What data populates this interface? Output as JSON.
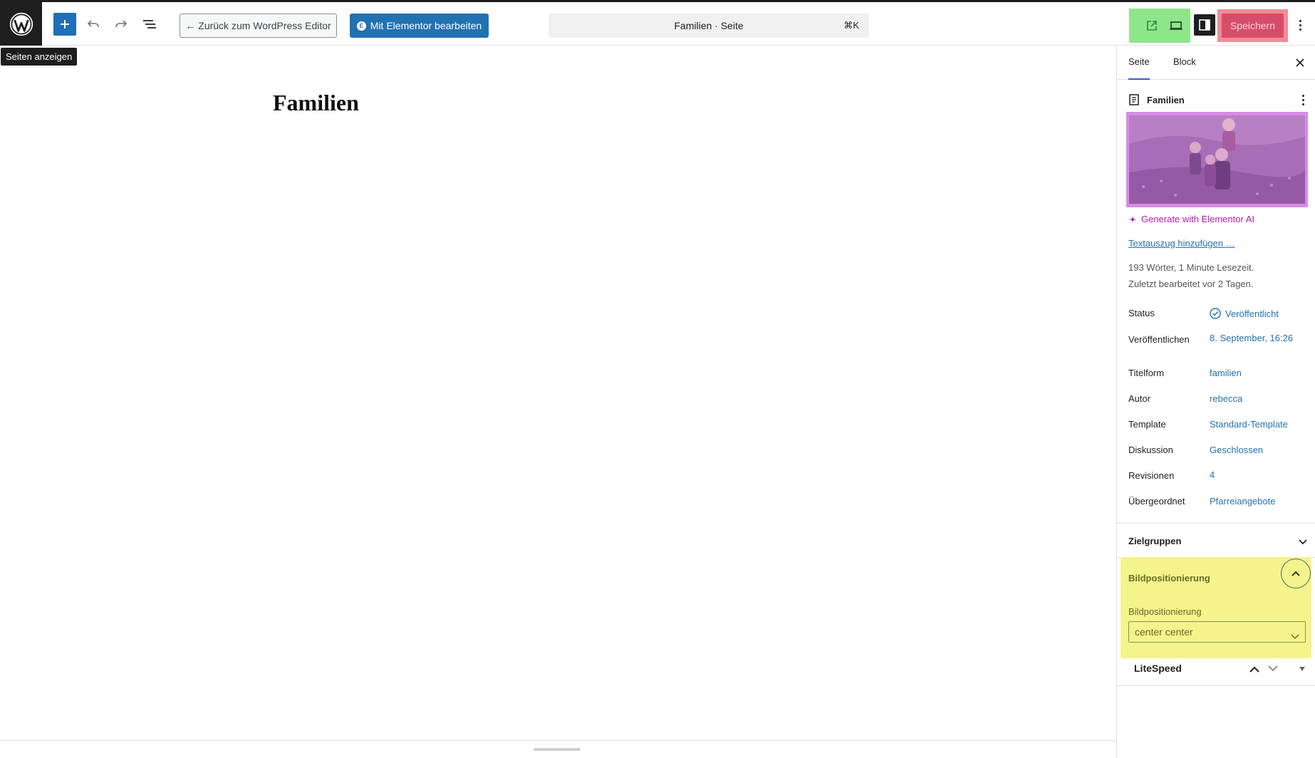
{
  "topbar": {
    "tooltip": "Seiten anzeigen",
    "back_button": "Zurück zum WordPress Editor",
    "elementor_button": "Mit Elementor bearbeiten",
    "command_title": "Familien · Seite",
    "command_shortcut": "⌘K",
    "save_button": "Speichern"
  },
  "canvas": {
    "page_title": "Familien"
  },
  "sidebar": {
    "tabs": [
      "Seite",
      "Block"
    ],
    "doc_title": "Familien",
    "ai_link": "Generate with Elementor AI",
    "excerpt_link": "Textauszug hinzufügen …",
    "word_count": "193 Wörter, 1 Minute Lesezeit.",
    "last_edited": "Zuletzt bearbeitet vor 2 Tagen.",
    "properties": [
      {
        "label": "Status",
        "value": "Veröffentlicht"
      },
      {
        "label": "Veröffentlichen",
        "value": "8. September, 16:26"
      },
      {
        "label": "Titelform",
        "value": "familien"
      },
      {
        "label": "Autor",
        "value": "rebecca"
      },
      {
        "label": "Template",
        "value": "Standard-Template"
      },
      {
        "label": "Diskussion",
        "value": "Geschlossen"
      },
      {
        "label": "Revisionen",
        "value": "4"
      },
      {
        "label": "Übergeordnet",
        "value": "Pfarreiangebote"
      }
    ],
    "zielgruppen": "Zielgruppen",
    "bildpositionierung": {
      "heading": "Bildpositionierung",
      "field_label": "Bildpositionierung",
      "selected": "center center"
    },
    "litespeed": "LiteSpeed"
  },
  "colors": {
    "accent": "#2271b1",
    "save_highlight": "#f28b95",
    "preview_highlight": "#8ee58a",
    "image_highlight": "#d98be6",
    "panel_highlight": "#f4f38c"
  }
}
